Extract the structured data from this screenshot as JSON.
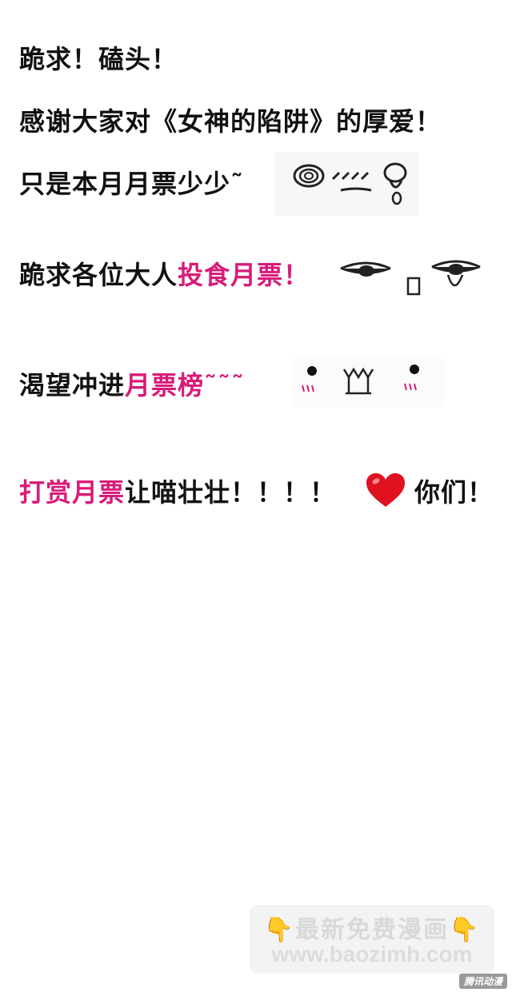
{
  "lines": {
    "l1": "跪求！磕头！",
    "l2": "感谢大家对《女神的陷阱》的厚爱！",
    "l3": "只是本月月票少少˜",
    "l4_a": "跪求各位大人",
    "l4_b": "投食月票！",
    "l5_a": "渴望冲进",
    "l5_b": "月票榜",
    "l5_c": "˜˜˜",
    "l6_a": "打赏月票",
    "l6_b": "让喵壮壮！！！！",
    "l6_c": "你们！"
  },
  "watermark": {
    "hand_left": "👇",
    "title": "最新免费漫画",
    "hand_right": "👇",
    "url": "www.baozimh.com",
    "corner_logo": "腾讯动漫"
  },
  "colors": {
    "text": "#111111",
    "highlight": "#d81b78",
    "heart": "#e0121f"
  },
  "icons": [
    "crying-face-emoticon",
    "tongue-out-face-emoticon",
    "blushing-face-emoticon",
    "heart-icon"
  ]
}
